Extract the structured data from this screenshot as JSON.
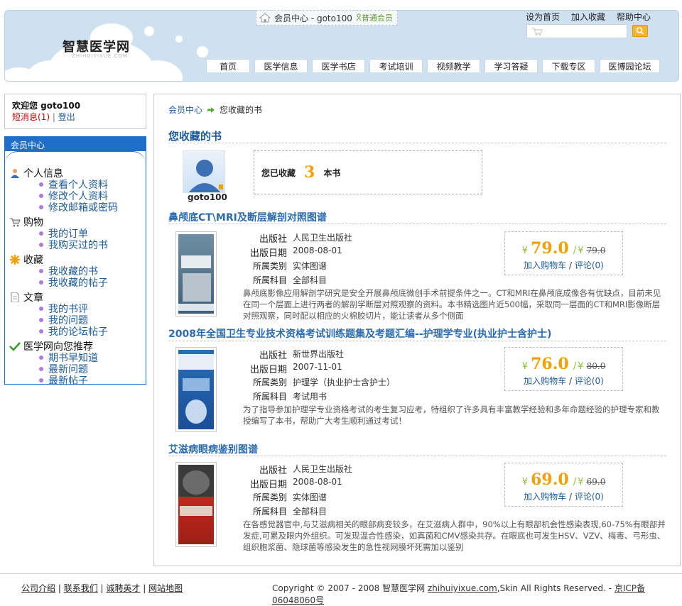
{
  "header": {
    "logo": "智慧医学网",
    "logo_sub": "ZHIHUIYIXUE.COM",
    "member_center": "会员中心 - goto100",
    "member_level": "普通会员",
    "top_links": [
      "设为首页",
      "加入收藏",
      "帮助中心"
    ],
    "search_placeholder": "",
    "nav": [
      "首页",
      "医学信息",
      "医学书店",
      "考试培训",
      "视频教学",
      "学习答疑",
      "下载专区",
      "医博园论坛"
    ]
  },
  "sidebar": {
    "welcome": "欢迎您 goto100",
    "messages": "短消息",
    "message_count": "(1)",
    "separator": "|",
    "logout": "登出",
    "menu_title": "会员中心",
    "sections": [
      {
        "title": "个人信息",
        "icon": "user-icon",
        "links": [
          "查看个人资料",
          "修改个人资料",
          "修改邮箱或密码"
        ]
      },
      {
        "title": "购物",
        "icon": "cart-icon",
        "links": [
          "我的订单",
          "我购买过的书"
        ]
      },
      {
        "title": "收藏",
        "icon": "star-icon",
        "links": [
          "我收藏的书",
          "我收藏的帖子"
        ]
      },
      {
        "title": "文章",
        "icon": "document-icon",
        "links": [
          "我的书评",
          "我的问题",
          "我的论坛帖子"
        ]
      },
      {
        "title": "医学网向您推荐",
        "icon": "checkmark-icon",
        "links": [
          "期书早知道",
          "最新问题",
          "最新帖子"
        ]
      }
    ]
  },
  "main": {
    "breadcrumb": {
      "home": "会员中心",
      "current": "您收藏的书"
    },
    "title": "您收藏的书",
    "username": "goto100",
    "count_prefix": "您已收藏",
    "count": "3",
    "count_suffix": "本书",
    "labels": {
      "publisher": "出版社",
      "date": "出版日期",
      "category": "所属类别",
      "subject": "所属科目"
    },
    "add_cart": "加入购物车",
    "comment": "评论",
    "currency": "¥",
    "books": [
      {
        "title": "鼻颅底CT\\MRI及断层解剖对照图谱",
        "publisher": "人民卫生出版社",
        "date": "2008-08-01",
        "category": "实体图谱",
        "subject": "全部科目",
        "price": "79.0",
        "old_price": "79.0",
        "comments": "(0)",
        "description": "鼻颅底影像应用解剖学研究是安全开展鼻颅底微创手术前提条件之一。CT和MRI在鼻颅底成像各有优缺点，目前未见在同一个层面上进行两者的解剖学断层对照观察的资料。本书精选图片近500幅，采取同一层面的CT和MRI影像断层对照观察，同时配以相应的火棉胶切片，能让读者从多个侧面"
      },
      {
        "title": "2008年全国卫生专业技术资格考试训练题集及考题汇编--护理学专业(执业护士含护士)",
        "publisher": "新世界出版社",
        "date": "2007-11-01",
        "category": "护理学（执业护士含护士）",
        "subject": "考试用书",
        "price": "76.0",
        "old_price": "80.0",
        "comments": "(0)",
        "description": "为了指导参加护理学专业资格考试的考生复习应考，特组织了许多具有丰富教学经验和多年命题经验的护理专家和教授编写了本书，帮助广大考生顺利通过考试！"
      },
      {
        "title": "艾滋病眼病鉴别图谱",
        "publisher": "人民卫生出版社",
        "date": "2008-08-01",
        "category": "实体图谱",
        "subject": "全部科目",
        "price": "69.0",
        "old_price": "69.0",
        "comments": "(0)",
        "description": "在各感觉器官中,与艾滋病相关的眼部病变较多，在艾滋病人群中，90%以上有眼部机会性感染表现,60-75%有眼部并发症,可累及眼内外组织。可发现温合性感染，如真菌和CMV感染共存。在眼底也可发生HSV、VZV、梅毒、弓形虫、组织胞浆菌、隐球菌等感染发生的急性视网膜坏死需加以鉴别"
      }
    ]
  },
  "footer": {
    "links": [
      "公司介绍",
      "联系我们",
      "诚聘英才",
      "网站地图"
    ],
    "copyright_prefix": "Copyright © 2007 - 2008 智慧医学网",
    "domain": "zhihuiyixue.com",
    "copyright_suffix": ",Skin All Rights Reserved. -",
    "icp": "京ICP备06048060号"
  }
}
